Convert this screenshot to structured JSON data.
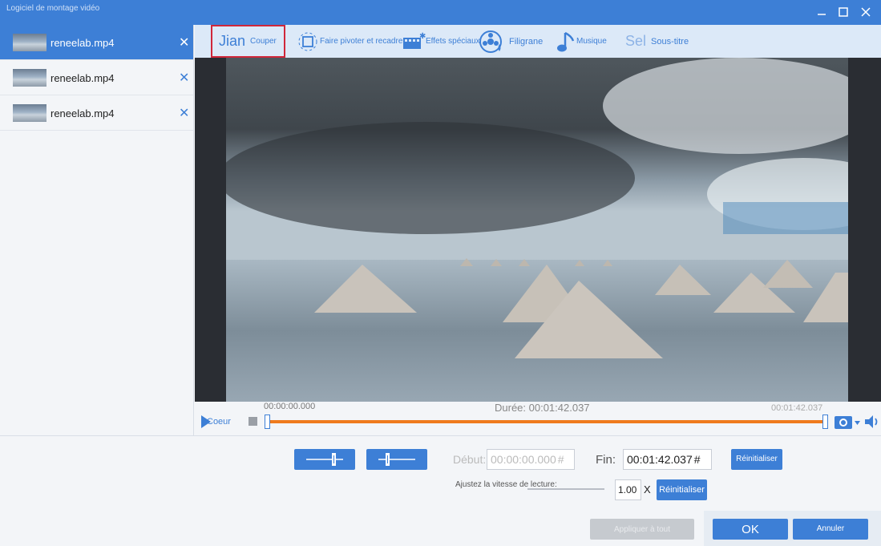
{
  "window": {
    "title": "Logiciel de montage vidéo"
  },
  "files": [
    {
      "name": "reneelab.mp4",
      "active": true
    },
    {
      "name": "reneelab.mp4",
      "active": false
    },
    {
      "name": "reneelab.mp4",
      "active": false
    }
  ],
  "toolbar": {
    "cut": {
      "big": "Jian",
      "label": "Couper"
    },
    "rotate": {
      "label": "Faire pivoter et recadrer"
    },
    "effects": {
      "label": "Effets spéciaux"
    },
    "watermark": {
      "label": "Filigrane"
    },
    "music": {
      "label": "Musique"
    },
    "subtitle": {
      "big": "Sel",
      "label": "Sous-titre"
    }
  },
  "timeline": {
    "start": "00:00:00.000",
    "end": "00:01:42.037",
    "duration": "Durée: 00:01:42.037",
    "play_label": "Coeur"
  },
  "edit": {
    "start_label": "Début:",
    "start_value": "00:00:00.000",
    "end_label": "Fin:",
    "end_value": "00:01:42.037",
    "reset_label": "Réinitialiser",
    "speed_label": "Ajustez la vitesse de lecture:",
    "speed_value": "1.00",
    "speed_unit": "X",
    "speed_reset_label": "Réinitialiser"
  },
  "footer": {
    "apply_all": "Appliquer à tout",
    "ok": "OK",
    "cancel": "Annuler"
  },
  "colors": {
    "accent": "#3d7fd6",
    "track": "#ef7b1e",
    "highlight": "#d0273a"
  }
}
